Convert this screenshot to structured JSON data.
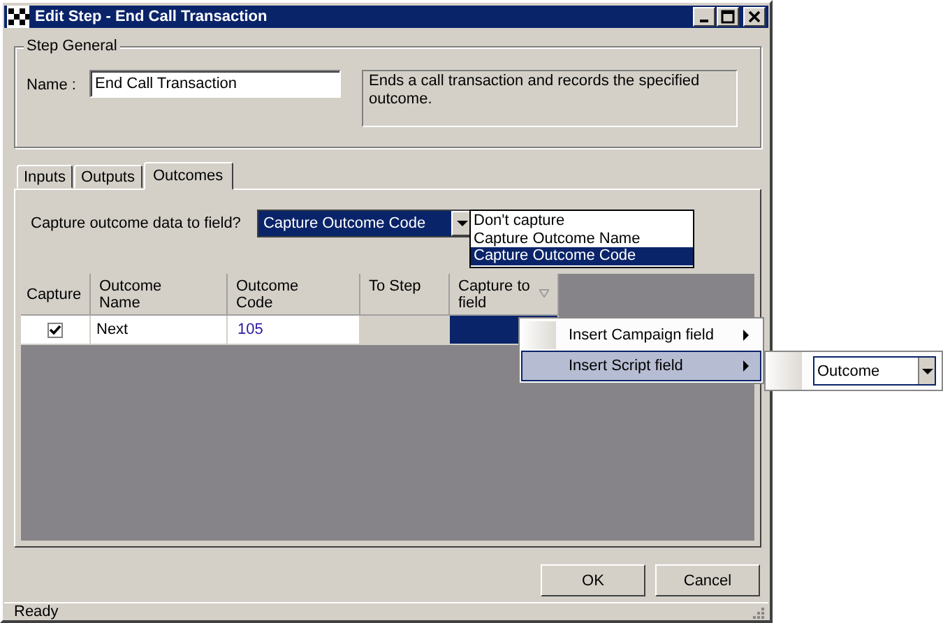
{
  "window": {
    "title": "Edit Step - End Call Transaction"
  },
  "step_general": {
    "title": "Step General",
    "name_label": "Name :",
    "name_value": "End Call Transaction",
    "description": "Ends a call transaction and records the specified outcome."
  },
  "tabs": [
    {
      "label": "Inputs",
      "selected": false
    },
    {
      "label": "Outputs",
      "selected": false
    },
    {
      "label": "Outcomes",
      "selected": true
    }
  ],
  "capture": {
    "label": "Capture outcome data to field?",
    "value": "Capture Outcome Code",
    "options": [
      {
        "label": "Don't capture",
        "selected": false
      },
      {
        "label": "Capture Outcome Name",
        "selected": false
      },
      {
        "label": "Capture Outcome Code",
        "selected": true
      }
    ]
  },
  "table": {
    "columns": [
      "Capture",
      "Outcome Name",
      "Outcome Code",
      "To Step",
      "Capture to field"
    ],
    "rows": [
      {
        "checked": true,
        "name": "Next",
        "code": "105",
        "field_cell_selected": true
      }
    ]
  },
  "context_menu": {
    "items": [
      {
        "label": "Insert Campaign field",
        "selected": false
      },
      {
        "label": "Insert Script field",
        "selected": true
      }
    ]
  },
  "submenu": {
    "value": "Outcome"
  },
  "buttons": [
    "OK",
    "Cancel"
  ],
  "status_bar": "Ready"
}
